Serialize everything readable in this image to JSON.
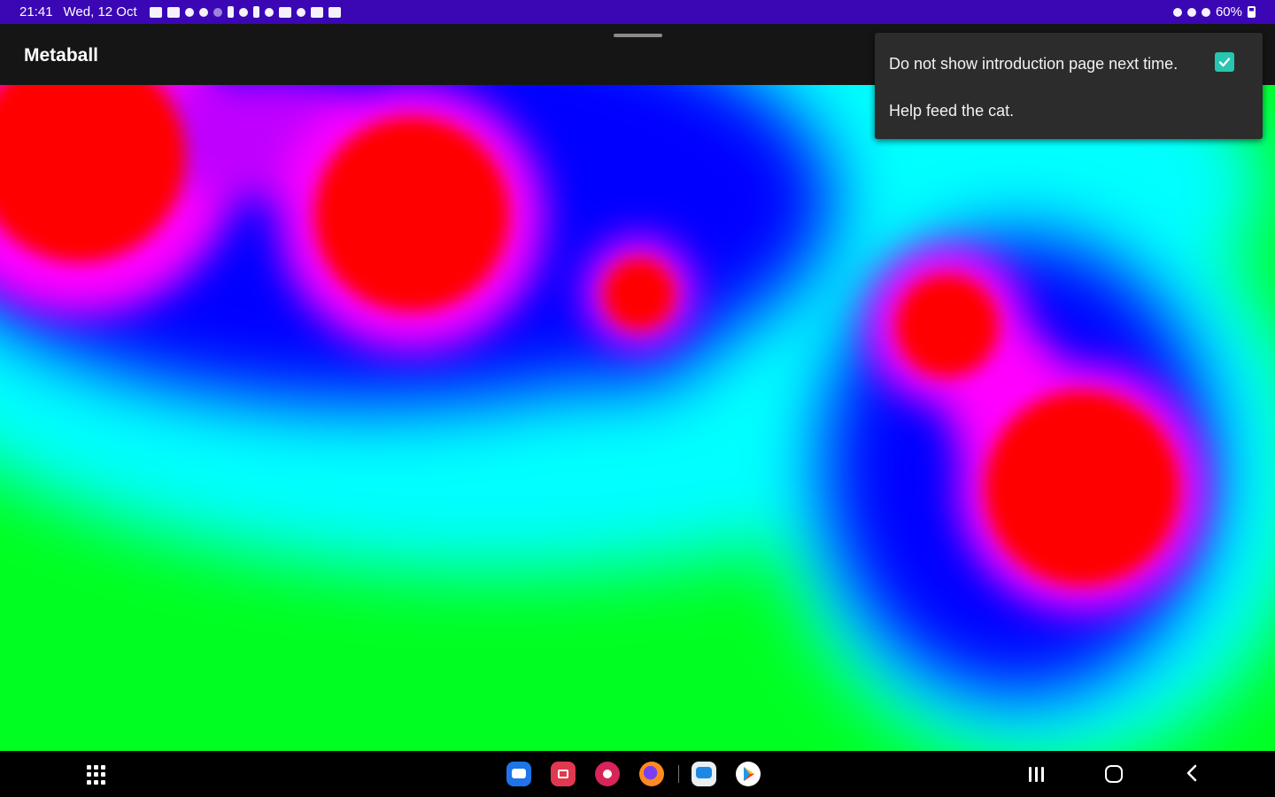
{
  "status_bar": {
    "time": "21:41",
    "date": "Wed, 12 Oct",
    "battery": "60%"
  },
  "app_bar": {
    "title": "Metaball"
  },
  "popup_menu": {
    "items": [
      {
        "label": "Do not show introduction page next time.",
        "checked": true
      },
      {
        "label": "Help feed the cat."
      }
    ]
  },
  "colors": {
    "status_bar": "#3b07b5",
    "app_bar": "#151515",
    "menu_bg": "#2c2c2c",
    "checkbox_accent": "#26c6b0"
  },
  "dock_apps": [
    {
      "icon": "messages-icon",
      "color": "#1e74e8"
    },
    {
      "icon": "screen-recorder-icon",
      "color": "#e0384f"
    },
    {
      "icon": "flower-app-icon",
      "color": "#d7245a"
    },
    {
      "icon": "firefox-icon",
      "color": "#ff8a1f"
    },
    {
      "icon": "chat-icon",
      "color": "#1e88e5"
    },
    {
      "icon": "play-store-icon",
      "color": "#ffffff"
    }
  ]
}
